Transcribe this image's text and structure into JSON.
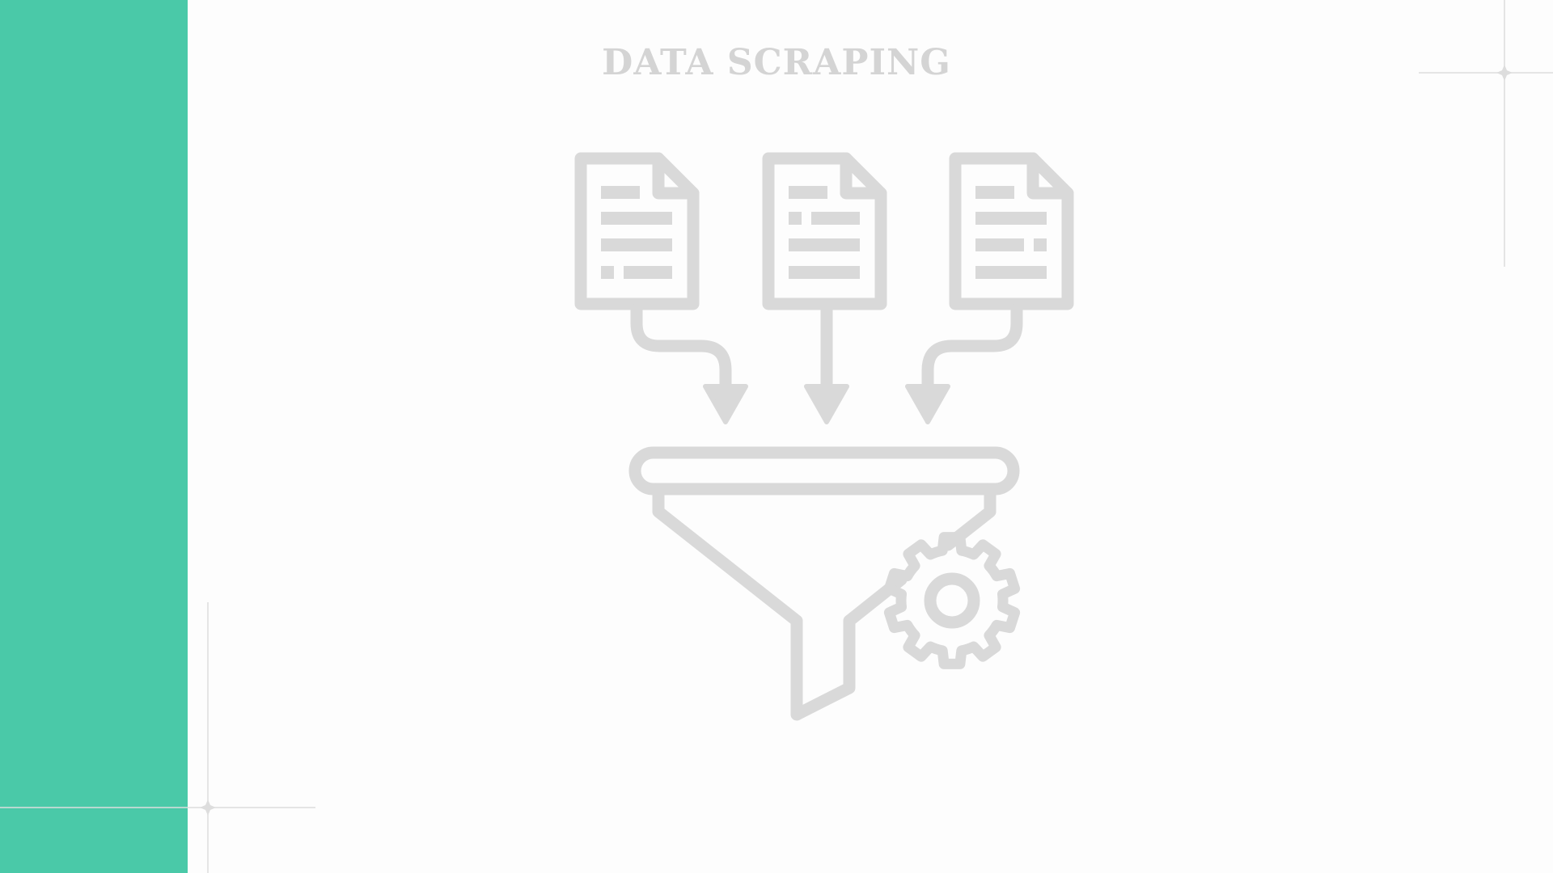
{
  "title": "DATA SCRAPING",
  "colors": {
    "accent": "#4ac9a8",
    "icon_gray": "#d9d9d9",
    "title_gray": "#d4d4d4",
    "deco_line": "#dddddd",
    "background": "#fdfdfd"
  },
  "icons": {
    "documents": [
      "document-icon",
      "document-icon",
      "document-icon"
    ],
    "arrows": [
      "arrow-down-icon",
      "arrow-down-icon",
      "arrow-down-icon"
    ],
    "funnel": "funnel-icon",
    "gear": "gear-icon"
  }
}
